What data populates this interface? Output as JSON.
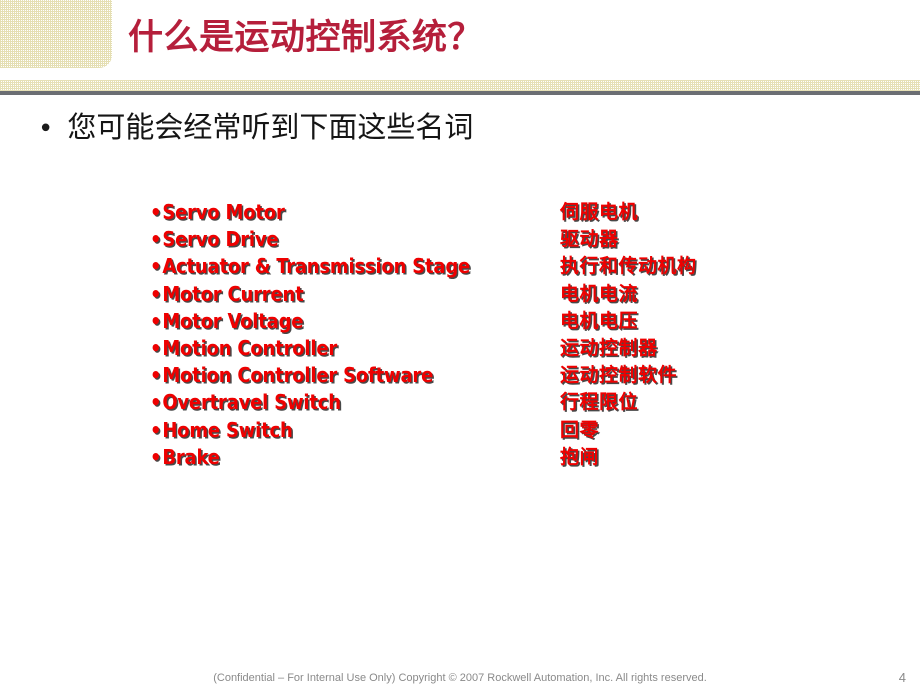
{
  "slide": {
    "title": "什么是运动控制系统？",
    "title_color": "#b51f3b",
    "intro_bullet_marker": "•",
    "intro_text": "您可能会经常听到下面这些名词",
    "list_marker": "•",
    "terms": [
      {
        "en": "Servo Motor",
        "zh": "伺服电机"
      },
      {
        "en": "Servo Drive",
        "zh": "驱动器"
      },
      {
        "en": "Actuator & Transmission Stage",
        "zh": "执行和传动机构"
      },
      {
        "en": "Motor Current",
        "zh": "电机电流"
      },
      {
        "en": "Motor Voltage",
        "zh": "电机电压"
      },
      {
        "en": "Motion Controller",
        "zh": "运动控制器"
      },
      {
        "en": "Motion Controller Software",
        "zh": "运动控制软件"
      },
      {
        "en": "Overtravel Switch",
        "zh": "行程限位"
      },
      {
        "en": "Home Switch",
        "zh": "回零"
      },
      {
        "en": "Brake",
        "zh": "抱闸"
      }
    ],
    "term_color": "#ee0000",
    "footer": "(Confidential – For Internal Use Only) Copyright © 2007 Rockwell Automation, Inc. All rights reserved.",
    "page_number": "4",
    "accent_beige": "#ddd49a",
    "rule_color": "#6b6e73"
  }
}
